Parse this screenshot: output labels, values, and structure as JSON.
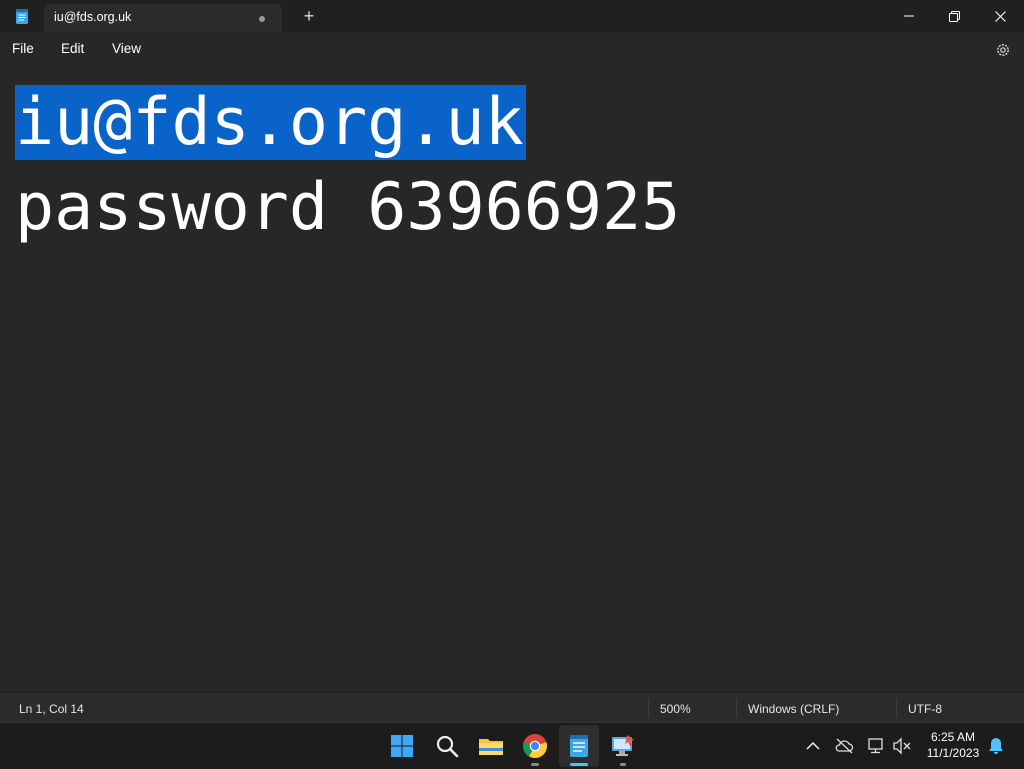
{
  "window": {
    "tab_title": "iu@fds.org.uk",
    "new_tab_glyph": "+",
    "controls": [
      "minimize-icon",
      "restore-icon",
      "close-icon"
    ]
  },
  "menu": {
    "file": "File",
    "edit": "Edit",
    "view": "View",
    "settings_icon": "gear-icon"
  },
  "document": {
    "line1": "iu@fds.org.uk",
    "line2": "password 63966925"
  },
  "status": {
    "position": "Ln 1, Col 14",
    "zoom": "500%",
    "line_endings": "Windows (CRLF)",
    "encoding": "UTF-8"
  },
  "taskbar": {
    "apps": [
      "windows-start-icon",
      "search-icon",
      "file-explorer-icon",
      "chrome-icon",
      "notepad-icon",
      "remote-desktop-icon"
    ],
    "time": "6:25 AM",
    "date": "11/1/2023"
  },
  "colors": {
    "selection": "#0a63c8",
    "editor_bg": "#272727",
    "accent": "#4cc2ff"
  }
}
